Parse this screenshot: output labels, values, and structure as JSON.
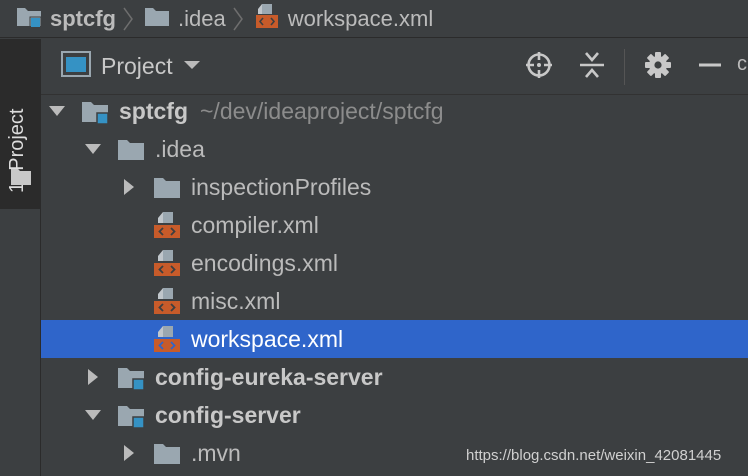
{
  "breadcrumb": {
    "items": [
      {
        "label": "sptcfg",
        "icon": "module-folder-icon"
      },
      {
        "label": ".idea",
        "icon": "folder-icon"
      },
      {
        "label": "workspace.xml",
        "icon": "xml-file-icon"
      }
    ]
  },
  "tool_window": {
    "stripe_label": "1: Project",
    "view_title": "Project",
    "edge_text": "c"
  },
  "tree": {
    "root": {
      "label": "sptcfg",
      "path": "~/dev/ideaproject/sptcfg"
    },
    "idea_folder": ".idea",
    "inspection_profiles": "inspectionProfiles",
    "files": {
      "compiler": "compiler.xml",
      "encodings": "encodings.xml",
      "misc": "misc.xml",
      "workspace": "workspace.xml"
    },
    "modules": {
      "eureka": "config-eureka-server",
      "server": "config-server"
    },
    "mvn_folder": ".mvn"
  },
  "watermark": "https://blog.csdn.net/weixin_42081445",
  "colors": {
    "background": "#3c3f41",
    "selection": "#2f65ca",
    "xml_badge": "#c75b2a",
    "module_badge": "#3592c4"
  }
}
